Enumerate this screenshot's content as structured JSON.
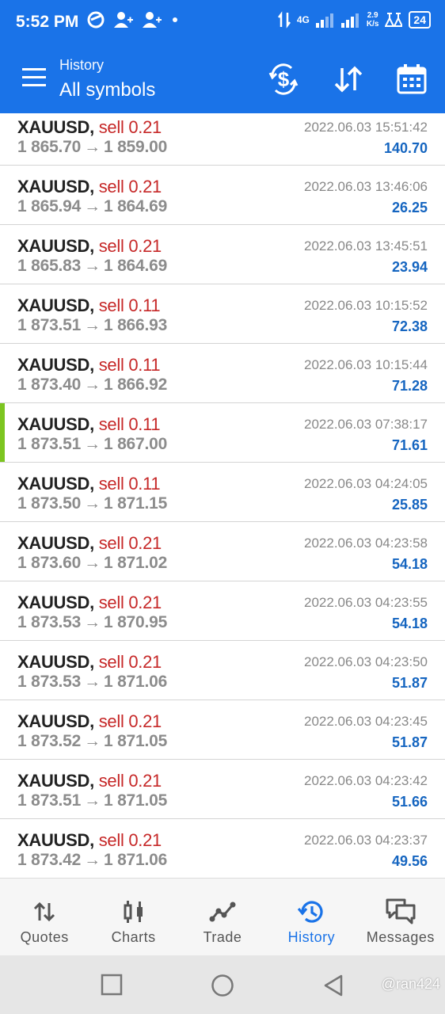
{
  "status_bar": {
    "time": "5:52 PM",
    "network": "4G",
    "speed_value": "2.9",
    "speed_unit": "K/s",
    "battery": "24"
  },
  "app_bar": {
    "subtitle": "History",
    "title": "All symbols"
  },
  "rows": [
    {
      "symbol": "XAUUSD,",
      "side": "sell 0.21",
      "open": "1 865.70",
      "close": "1 859.00",
      "datetime": "2022.06.03 15:51:42",
      "profit": "140.70"
    },
    {
      "symbol": "XAUUSD,",
      "side": "sell 0.21",
      "open": "1 865.94",
      "close": "1 864.69",
      "datetime": "2022.06.03 13:46:06",
      "profit": "26.25"
    },
    {
      "symbol": "XAUUSD,",
      "side": "sell 0.21",
      "open": "1 865.83",
      "close": "1 864.69",
      "datetime": "2022.06.03 13:45:51",
      "profit": "23.94"
    },
    {
      "symbol": "XAUUSD,",
      "side": "sell 0.11",
      "open": "1 873.51",
      "close": "1 866.93",
      "datetime": "2022.06.03 10:15:52",
      "profit": "72.38"
    },
    {
      "symbol": "XAUUSD,",
      "side": "sell 0.11",
      "open": "1 873.40",
      "close": "1 866.92",
      "datetime": "2022.06.03 10:15:44",
      "profit": "71.28"
    },
    {
      "symbol": "XAUUSD,",
      "side": "sell 0.11",
      "open": "1 873.51",
      "close": "1 867.00",
      "datetime": "2022.06.03 07:38:17",
      "profit": "71.61"
    },
    {
      "symbol": "XAUUSD,",
      "side": "sell 0.11",
      "open": "1 873.50",
      "close": "1 871.15",
      "datetime": "2022.06.03 04:24:05",
      "profit": "25.85"
    },
    {
      "symbol": "XAUUSD,",
      "side": "sell 0.21",
      "open": "1 873.60",
      "close": "1 871.02",
      "datetime": "2022.06.03 04:23:58",
      "profit": "54.18"
    },
    {
      "symbol": "XAUUSD,",
      "side": "sell 0.21",
      "open": "1 873.53",
      "close": "1 870.95",
      "datetime": "2022.06.03 04:23:55",
      "profit": "54.18"
    },
    {
      "symbol": "XAUUSD,",
      "side": "sell 0.21",
      "open": "1 873.53",
      "close": "1 871.06",
      "datetime": "2022.06.03 04:23:50",
      "profit": "51.87"
    },
    {
      "symbol": "XAUUSD,",
      "side": "sell 0.21",
      "open": "1 873.52",
      "close": "1 871.05",
      "datetime": "2022.06.03 04:23:45",
      "profit": "51.87"
    },
    {
      "symbol": "XAUUSD,",
      "side": "sell 0.21",
      "open": "1 873.51",
      "close": "1 871.05",
      "datetime": "2022.06.03 04:23:42",
      "profit": "51.66"
    },
    {
      "symbol": "XAUUSD,",
      "side": "sell 0.21",
      "open": "1 873.42",
      "close": "1 871.06",
      "datetime": "2022.06.03 04:23:37",
      "profit": "49.56"
    }
  ],
  "bottom_nav": {
    "quotes": "Quotes",
    "charts": "Charts",
    "trade": "Trade",
    "history": "History",
    "messages": "Messages"
  },
  "watermark": "@ran424",
  "colors": {
    "primary": "#1a73e8",
    "sell": "#c62828",
    "profit": "#1565c0",
    "marker": "#7cc520"
  }
}
